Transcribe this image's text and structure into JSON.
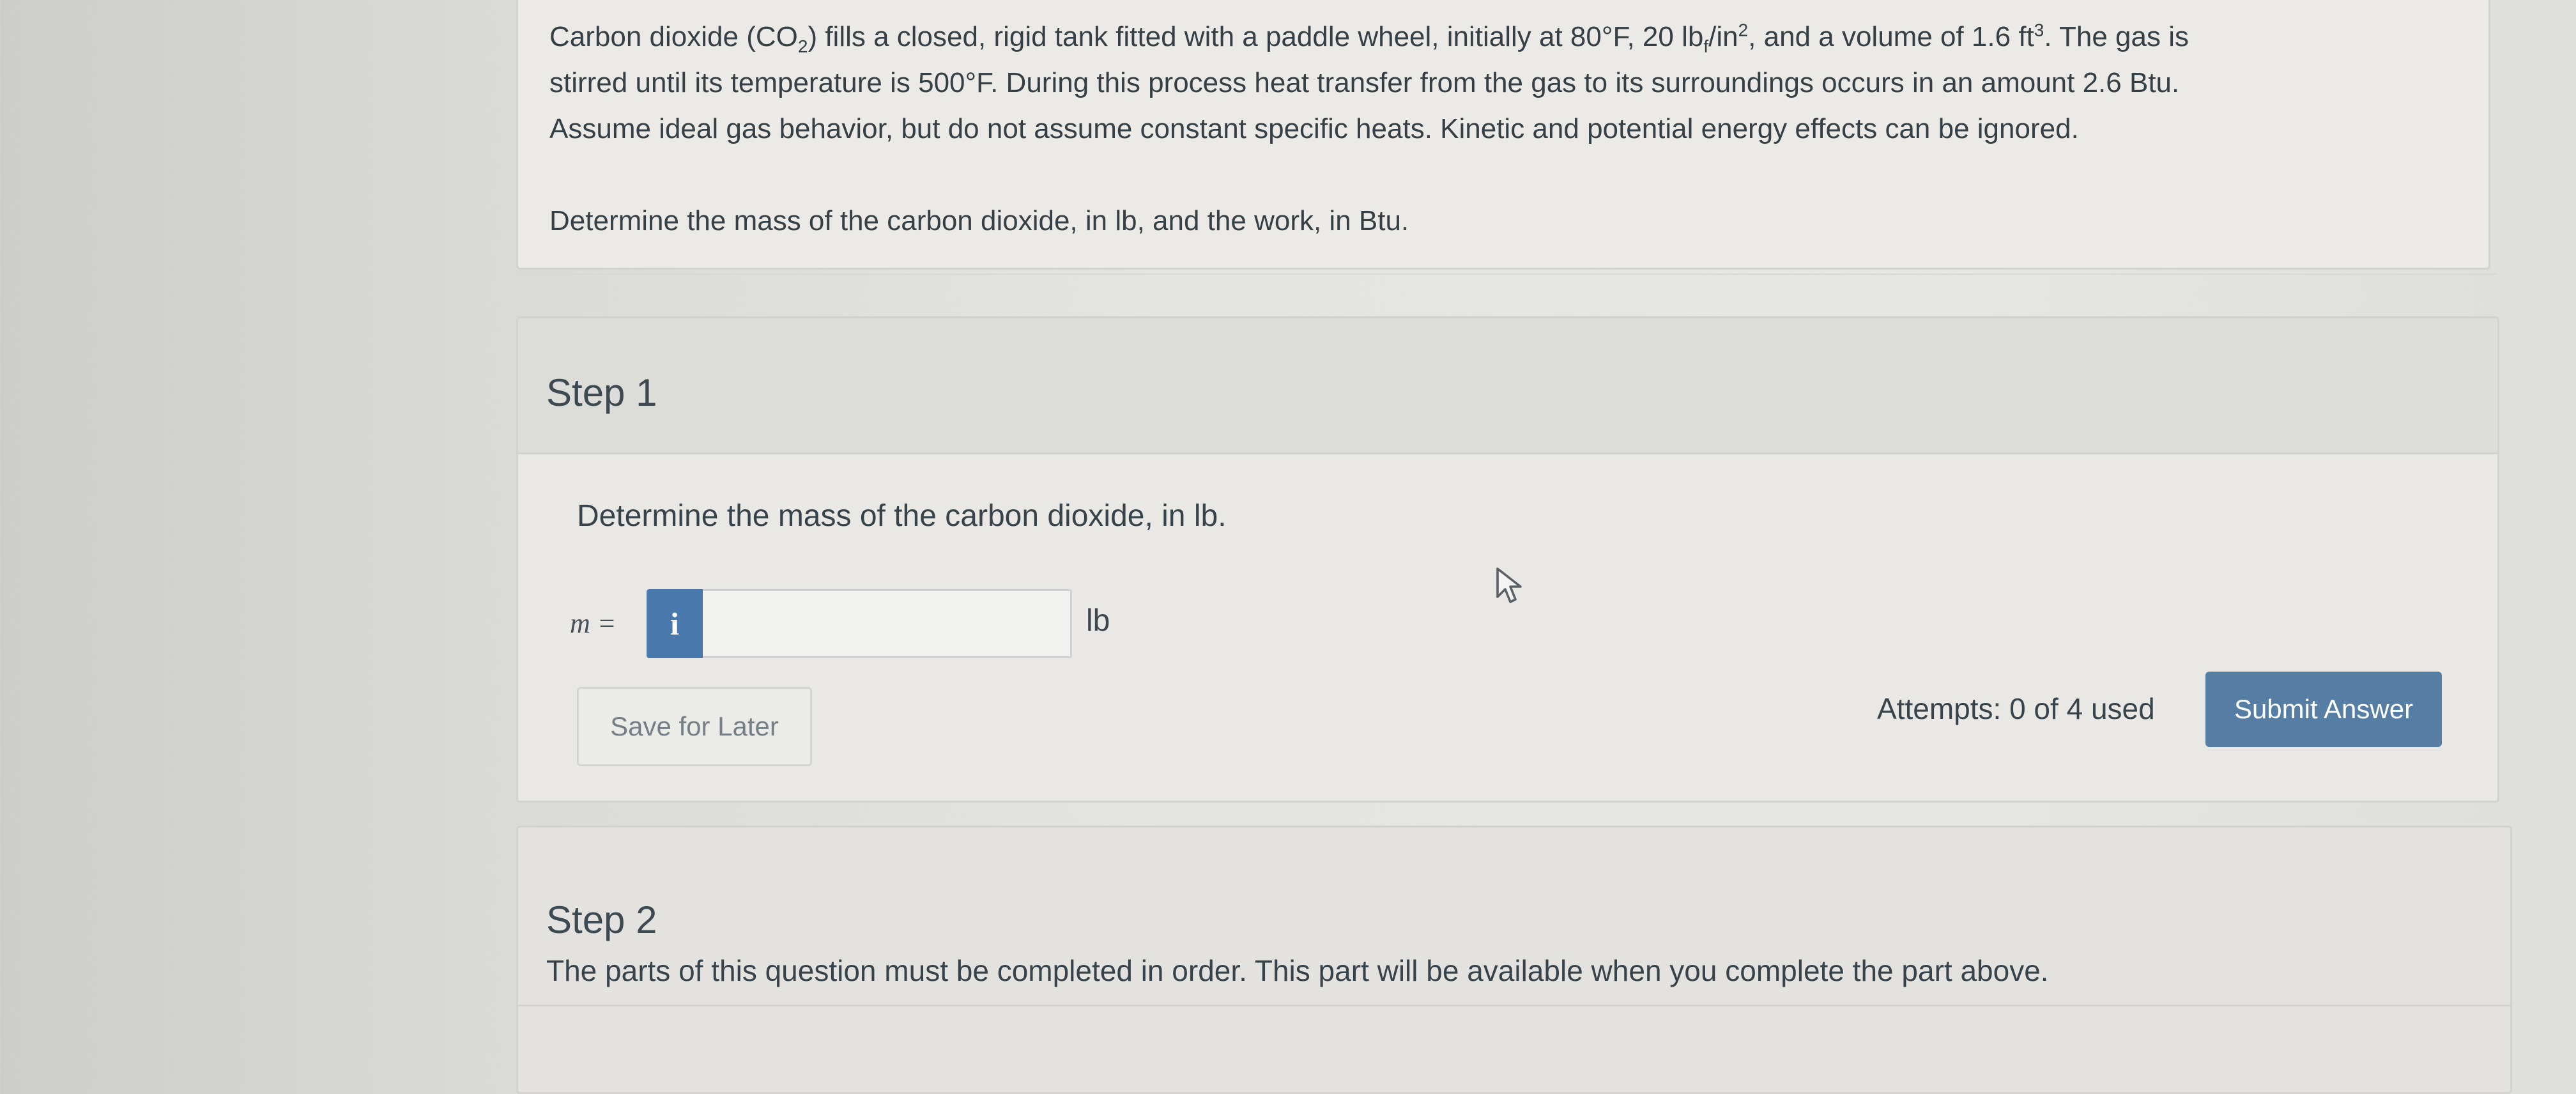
{
  "problem": {
    "line1_pre": "Carbon dioxide (CO",
    "line1_sub": "2",
    "line1_mid": ") fills a closed, rigid tank fitted with a paddle wheel, initially at 80°F, 20 lb",
    "line1_sub_f": "f",
    "line1_mid2": "/in",
    "line1_sup2": "2",
    "line1_mid3": ", and a volume of 1.6 ft",
    "line1_sup3": "3",
    "line1_post": ". The gas is",
    "line2": "stirred until its temperature is 500°F. During this process heat transfer from the gas to its surroundings occurs in an amount 2.6 Btu.",
    "line3": "Assume ideal gas behavior, but do not assume constant specific heats. Kinetic and potential energy effects can be ignored.",
    "question": "Determine the mass of the carbon dioxide, in lb, and the work, in Btu."
  },
  "step1": {
    "title": "Step 1",
    "prompt": "Determine the mass of the carbon dioxide, in lb.",
    "answer_label": "m =",
    "info_icon": "i",
    "input_value": "",
    "unit": "lb",
    "save_label": "Save for Later",
    "attempts": "Attempts: 0 of 4 used",
    "submit_label": "Submit Answer"
  },
  "step2": {
    "title": "Step 2",
    "message": "The parts of this question must be completed in order. This part will be available when you complete the part above."
  },
  "colors": {
    "submit_button": "#567da4",
    "info_button": "#4a79ad"
  },
  "icons": {
    "cursor": "mouse-pointer-icon",
    "info": "info-icon"
  }
}
